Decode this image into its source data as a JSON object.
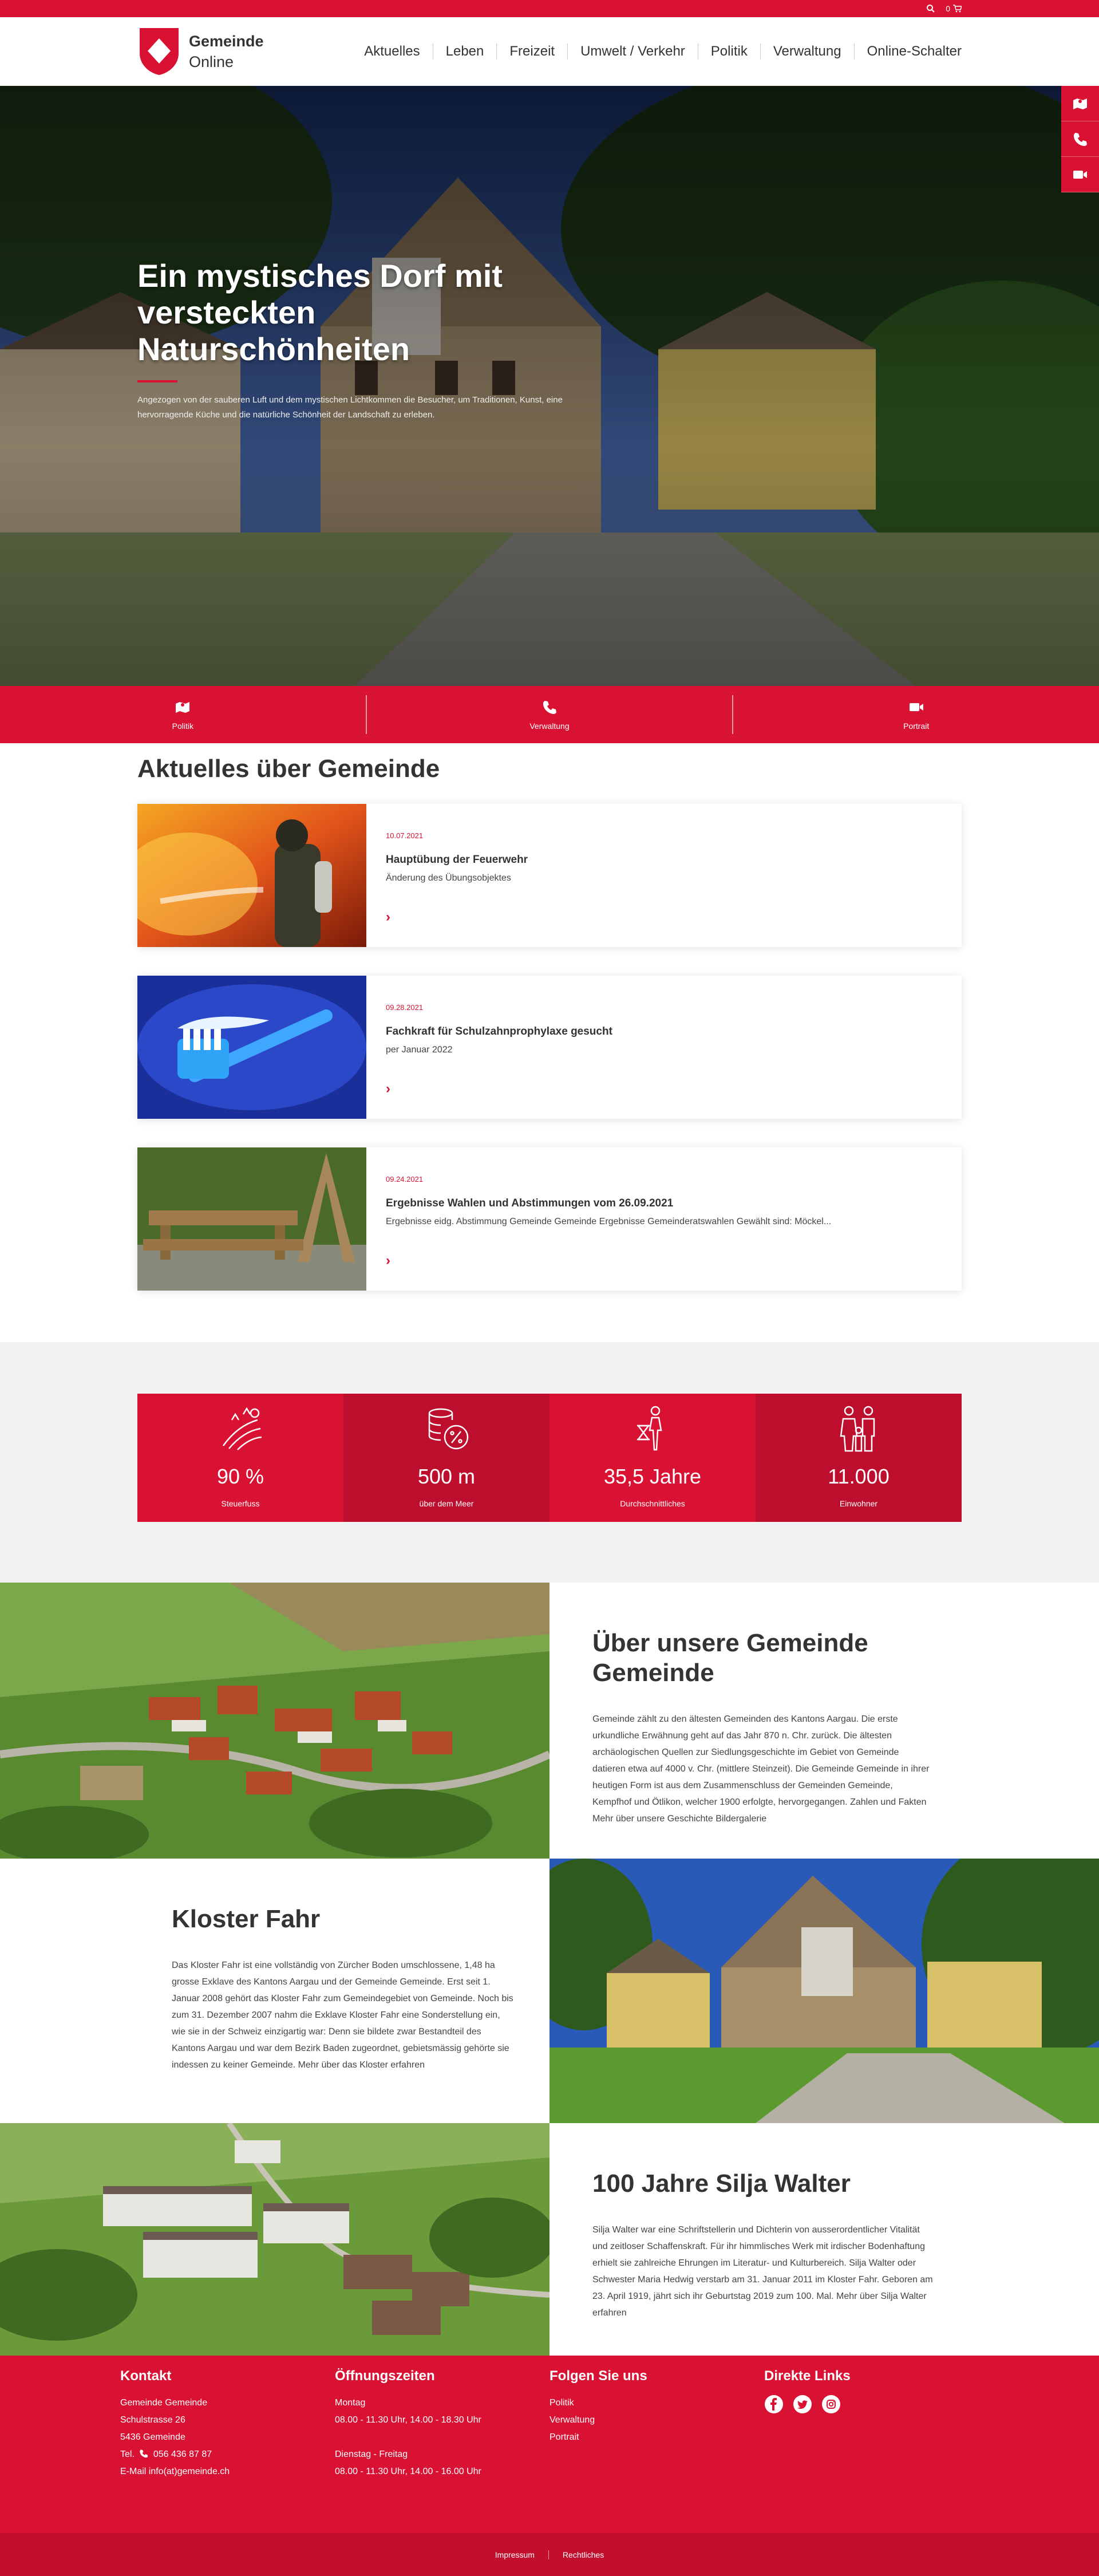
{
  "topbar": {
    "cart_count": "0"
  },
  "header": {
    "logo_line1": "Gemeinde",
    "logo_line2": "Online"
  },
  "nav": [
    "Aktuelles",
    "Leben",
    "Freizeit",
    "Umwelt / Verkehr",
    "Politik",
    "Verwaltung",
    "Online-Schalter"
  ],
  "side_icons": [
    "map-icon",
    "phone-icon",
    "video-icon"
  ],
  "hero": {
    "title": "Ein mystisches Dorf mit versteckten Naturschönheiten",
    "text": "Angezogen von der sauberen Luft und dem mystischen Lichtkommen die Besucher, um Traditionen, Kunst, eine hervorragende Küche und die natürliche Schönheit der Landschaft zu erleben."
  },
  "quick_links": [
    {
      "label": "Politik",
      "icon": "map-icon"
    },
    {
      "label": "Verwaltung",
      "icon": "phone-icon"
    },
    {
      "label": "Portrait",
      "icon": "video-icon"
    }
  ],
  "news": {
    "heading": "Aktuelles über Gemeinde",
    "items": [
      {
        "date": "10.07.2021",
        "title": "Hauptübung der Feuerwehr",
        "subtitle": "Änderung des Übungsobjektes"
      },
      {
        "date": "09.28.2021",
        "title": "Fachkraft für Schulzahnprophylaxe gesucht",
        "subtitle": "per Januar 2022"
      },
      {
        "date": "09.24.2021",
        "title": "Ergebnisse Wahlen und Abstimmungen vom 26.09.2021",
        "subtitle": "Ergebnisse eidg. Abstimmung Gemeinde Gemeinde Ergebnisse Gemeinderatswahlen Gewählt sind: Möckel..."
      }
    ]
  },
  "stats": [
    {
      "value": "90 %",
      "label": "Steuerfuss",
      "icon": "field-icon"
    },
    {
      "value": "500 m",
      "label": "über dem Meer",
      "icon": "coins-percent-icon"
    },
    {
      "value": "35,5 Jahre",
      "label": "Durchschnittliches",
      "icon": "person-hourglass-icon"
    },
    {
      "value": "11.000",
      "label": "Einwohner",
      "icon": "family-icon"
    }
  ],
  "sections": [
    {
      "title": "Über unsere Gemeinde Gemeinde",
      "text": "Gemeinde zählt zu den ältesten Gemeinden des Kantons Aargau. Die erste urkundliche Erwähnung geht auf das Jahr 870 n. Chr. zurück. Die ältesten archäologischen Quellen zur Siedlungsgeschichte im Gebiet von Gemeinde datieren etwa auf 4000 v. Chr. (mittlere Steinzeit). Die Gemeinde Gemeinde in ihrer heutigen Form ist aus dem Zusammenschluss der Gemeinden Gemeinde, Kempfhof und Ötlikon, welcher 1900 erfolgte, hervorgegangen. Zahlen und Fakten Mehr über unsere Geschichte Bildergalerie"
    },
    {
      "title": "Kloster Fahr",
      "text": "Das Kloster Fahr ist eine vollständig von Zürcher Boden umschlossene, 1,48 ha grosse Exklave des Kantons Aargau und der Gemeinde Gemeinde. Erst seit 1. Januar 2008 gehört das Kloster Fahr zum Gemeindegebiet von Gemeinde. Noch bis zum 31. Dezember 2007 nahm die Exklave Kloster Fahr eine Sonderstellung ein, wie sie in der Schweiz einzigartig war: Denn sie bildete zwar Bestandteil des Kantons Aargau und war dem Bezirk Baden zugeordnet, gebietsmässig gehörte sie indessen zu keiner Gemeinde. Mehr über das Kloster erfahren"
    },
    {
      "title": "100 Jahre Silja Walter",
      "text": "Silja Walter war eine Schriftstellerin und Dichterin von ausserordentlicher Vitalität und zeitloser Schaffenskraft. Für ihr himmlisches Werk mit irdischer Bodenhaftung erhielt sie zahlreiche Ehrungen im Literatur- und Kulturbereich. Silja Walter oder Schwester Maria Hedwig verstarb am 31. Januar 2011 im Kloster Fahr. Geboren am 23. April 1919, jährt sich ihr Geburtstag 2019 zum 100. Mal. Mehr über Silja Walter erfahren"
    }
  ],
  "footer": {
    "kontakt": {
      "heading": "Kontakt",
      "name": "Gemeinde Gemeinde",
      "street": "Schulstrasse 26",
      "city": "5436 Gemeinde",
      "tel_prefix": "Tel.",
      "tel": "056 436 87 87",
      "email": "E-Mail info(at)gemeinde.ch"
    },
    "hours": {
      "heading": "Öffnungszeiten",
      "day1": "Montag",
      "time1": "08.00 - 11.30 Uhr, 14.00 - 18.30 Uhr",
      "day2": "Dienstag - Freitag",
      "time2": "08.00 - 11.30 Uhr, 14.00 - 16.00 Uhr"
    },
    "follow": {
      "heading": "Folgen Sie uns",
      "links": [
        "Politik",
        "Verwaltung",
        "Portrait"
      ]
    },
    "direct": {
      "heading": "Direkte Links",
      "icons": [
        "facebook-icon",
        "twitter-icon",
        "instagram-icon"
      ]
    },
    "bottom_links": [
      "Impressum",
      "Rechtliches"
    ]
  },
  "colors": {
    "brand": "#d91133",
    "brand_dark": "#be0e2d"
  }
}
